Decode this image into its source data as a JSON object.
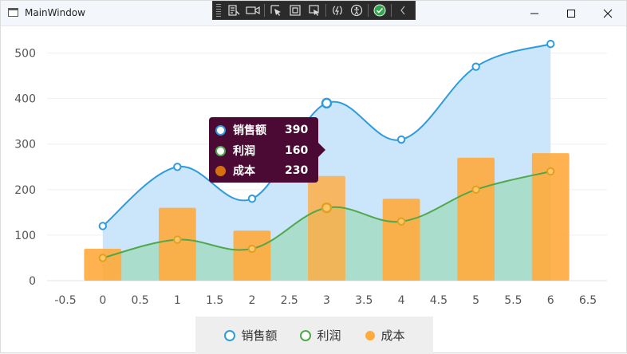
{
  "window": {
    "title": "MainWindow"
  },
  "legend": [
    {
      "name": "销售额",
      "kind": "ring",
      "color": "#2e9bdc"
    },
    {
      "name": "利润",
      "kind": "ring",
      "color": "#4fa84a"
    },
    {
      "name": "成本",
      "kind": "dot",
      "color": "#ffab40"
    }
  ],
  "tooltip": {
    "rows": [
      {
        "name": "销售额",
        "value": "390",
        "color": "#2e9bdc",
        "kind": "ring"
      },
      {
        "name": "利润",
        "value": "160",
        "color": "#4fa84a",
        "kind": "ring"
      },
      {
        "name": "成本",
        "value": "230",
        "color": "#d4700e",
        "kind": "dot"
      }
    ]
  },
  "chart_data": {
    "type": "line",
    "x": [
      0,
      1,
      2,
      3,
      4,
      5,
      6
    ],
    "series": [
      {
        "name": "销售额",
        "type": "area",
        "values": [
          120,
          250,
          180,
          390,
          310,
          470,
          520
        ],
        "color": "#2e9bdc",
        "fill": "#cbe6fb"
      },
      {
        "name": "利润",
        "type": "area",
        "values": [
          50,
          90,
          70,
          160,
          130,
          200,
          240
        ],
        "color": "#4fa84a",
        "fill": "#a6dbc4"
      },
      {
        "name": "成本",
        "type": "bar",
        "values": [
          70,
          160,
          110,
          230,
          180,
          270,
          280
        ],
        "color": "#ffab40"
      }
    ],
    "xlim": [
      -0.5,
      6.5
    ],
    "ylim": [
      0,
      550
    ],
    "xticks": [
      "-0.5",
      "0",
      "0.5",
      "1",
      "1.5",
      "2",
      "2.5",
      "3",
      "3.5",
      "4",
      "4.5",
      "5",
      "5.5",
      "6",
      "6.5"
    ],
    "yticks": [
      "0",
      "100",
      "200",
      "300",
      "400",
      "500"
    ],
    "highlight_index": 3,
    "grid": true,
    "legend_position": "bottom"
  }
}
